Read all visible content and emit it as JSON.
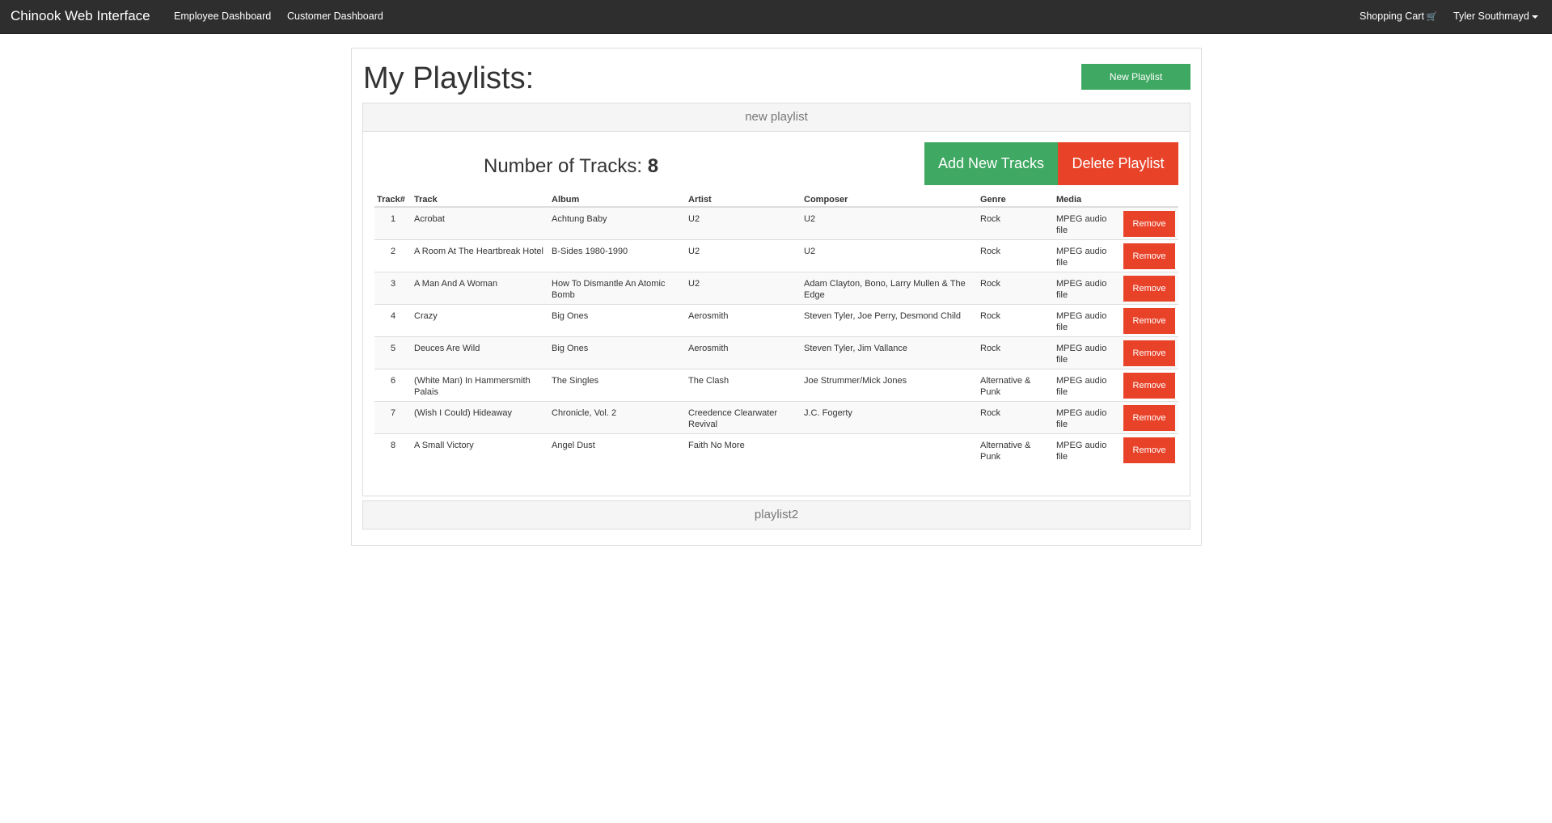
{
  "navbar": {
    "brand": "Chinook Web Interface",
    "links": [
      "Employee Dashboard",
      "Customer Dashboard"
    ],
    "cart_label": "Shopping Cart",
    "user_label": "Tyler Southmayd"
  },
  "page": {
    "title": "My Playlists:",
    "new_playlist_label": "New Playlist"
  },
  "playlists": [
    {
      "name": "new playlist",
      "count_label": "Number of Tracks:",
      "count": "8",
      "add_label": "Add New Tracks",
      "delete_label": "Delete Playlist",
      "columns": [
        "Track#",
        "Track",
        "Album",
        "Artist",
        "Composer",
        "Genre",
        "Media"
      ],
      "remove_label": "Remove",
      "rows": [
        {
          "num": "1",
          "track": "Acrobat",
          "album": "Achtung Baby",
          "artist": "U2",
          "composer": "U2",
          "genre": "Rock",
          "media": "MPEG audio file"
        },
        {
          "num": "2",
          "track": "A Room At The Heartbreak Hotel",
          "album": "B-Sides 1980-1990",
          "artist": "U2",
          "composer": "U2",
          "genre": "Rock",
          "media": "MPEG audio file"
        },
        {
          "num": "3",
          "track": "A Man And A Woman",
          "album": "How To Dismantle An Atomic Bomb",
          "artist": "U2",
          "composer": "Adam Clayton, Bono, Larry Mullen & The Edge",
          "genre": "Rock",
          "media": "MPEG audio file"
        },
        {
          "num": "4",
          "track": "Crazy",
          "album": "Big Ones",
          "artist": "Aerosmith",
          "composer": "Steven Tyler, Joe Perry, Desmond Child",
          "genre": "Rock",
          "media": "MPEG audio file"
        },
        {
          "num": "5",
          "track": "Deuces Are Wild",
          "album": "Big Ones",
          "artist": "Aerosmith",
          "composer": "Steven Tyler, Jim Vallance",
          "genre": "Rock",
          "media": "MPEG audio file"
        },
        {
          "num": "6",
          "track": "(White Man) In Hammersmith Palais",
          "album": "The Singles",
          "artist": "The Clash",
          "composer": "Joe Strummer/Mick Jones",
          "genre": "Alternative & Punk",
          "media": "MPEG audio file"
        },
        {
          "num": "7",
          "track": "(Wish I Could) Hideaway",
          "album": "Chronicle, Vol. 2",
          "artist": "Creedence Clearwater Revival",
          "composer": "J.C. Fogerty",
          "genre": "Rock",
          "media": "MPEG audio file"
        },
        {
          "num": "8",
          "track": "A Small Victory",
          "album": "Angel Dust",
          "artist": "Faith No More",
          "composer": "",
          "genre": "Alternative & Punk",
          "media": "MPEG audio file"
        }
      ]
    },
    {
      "name": "playlist2"
    }
  ]
}
